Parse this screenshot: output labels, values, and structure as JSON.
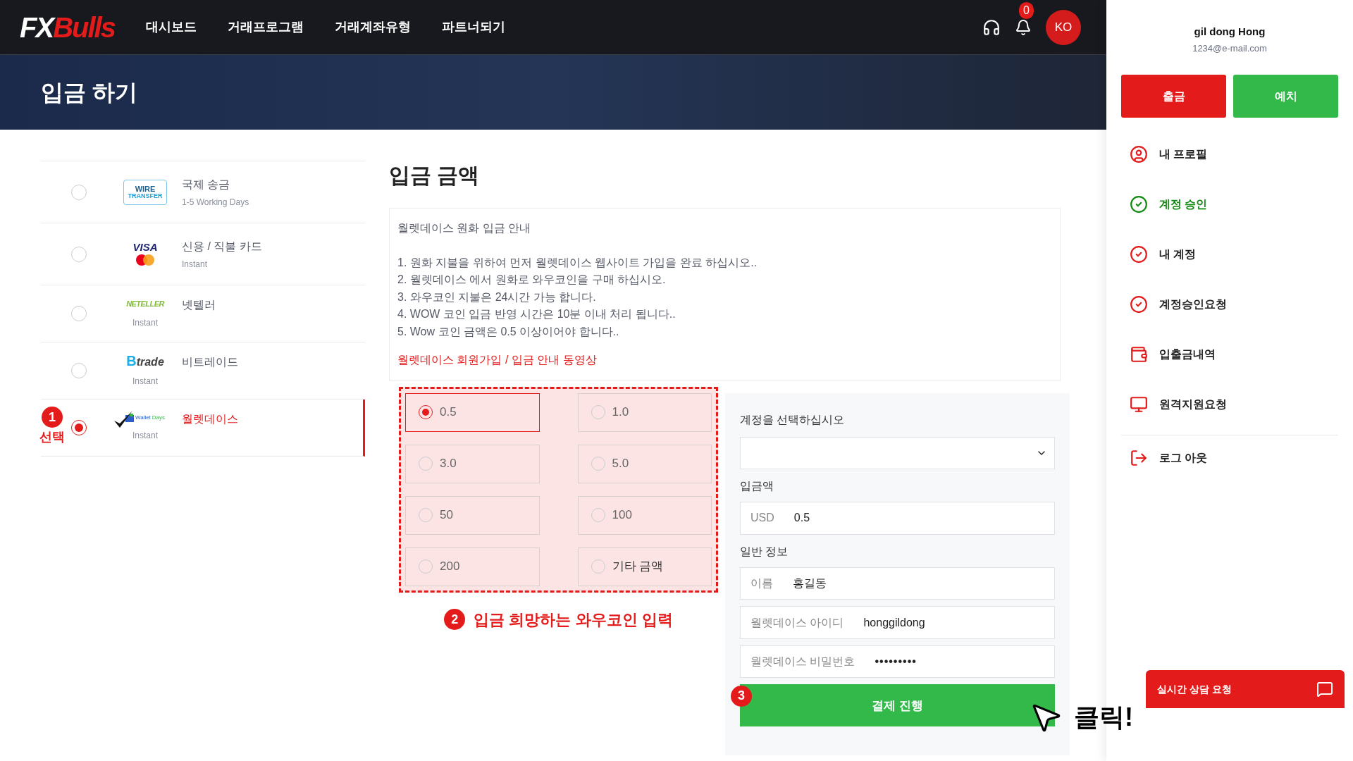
{
  "nav": {
    "logo": {
      "part1": "FX",
      "part2": "Bulls"
    },
    "items": [
      "대시보드",
      "거래프로그램",
      "거래계좌유형",
      "파트너되기"
    ],
    "notification_count": "0",
    "avatar": "KO"
  },
  "page_title": "입금 하기",
  "methods": [
    {
      "logo": {
        "kind": "wire",
        "lines": [
          "WIRE",
          "TRANSFER"
        ]
      },
      "name": "국제 송금",
      "note": "1-5 Working Days",
      "kind": "beside",
      "selected": false
    },
    {
      "logo": {
        "kind": "visa",
        "lines": [
          "VISA"
        ]
      },
      "name": "신용 / 직불 카드",
      "note": "Instant",
      "kind": "beside",
      "selected": false
    },
    {
      "logo": {
        "kind": "neteller",
        "lines": [
          "NETELLER"
        ]
      },
      "name": "넷텔러",
      "note": "Instant",
      "kind": "under",
      "selected": false
    },
    {
      "logo": {
        "kind": "btrade",
        "lines": [
          "B",
          "trade"
        ]
      },
      "name": "비트레이드",
      "note": "Instant",
      "kind": "under",
      "selected": false
    },
    {
      "logo": {
        "kind": "walletdays",
        "lines": [
          "Wallet",
          "Days"
        ]
      },
      "name": "월렛데이스",
      "note": "Instant",
      "kind": "under",
      "selected": true
    }
  ],
  "section_title": "입금 금액",
  "info": {
    "title": "월렛데이스 원화 입금 안내",
    "lines": [
      "1. 원화 지불을 위하여 먼저 월렛데이스 웹사이트 가입을 완료 하십시오..",
      "2. 월렛데이스 에서 원화로 와우코인을 구매 하십시오.",
      "3. 와우코인 지불은 24시간 가능 합니다.",
      "4. WOW 코인 입금 반영 시간은 10분 이내 처리 됩니다..",
      "5. Wow 코인 금액은 0.5 이상이어야 합니다.."
    ],
    "link": "월렛데이스 회원가입 / 입금 안내 동영상"
  },
  "amounts": [
    {
      "label": "0.5",
      "selected": true
    },
    {
      "label": "1.0",
      "selected": false
    },
    {
      "label": "3.0",
      "selected": false
    },
    {
      "label": "5.0",
      "selected": false
    },
    {
      "label": "50",
      "selected": false
    },
    {
      "label": "100",
      "selected": false
    },
    {
      "label": "200",
      "selected": false
    },
    {
      "label": "기타 금액",
      "selected": false
    }
  ],
  "form": {
    "account_label": "계정을 선택하십시오",
    "amount_label": "입금액",
    "amount": {
      "prefix": "USD",
      "value": "0.5"
    },
    "general_label": "일반 정보",
    "fields": [
      {
        "label": "이름",
        "value": "홍길동",
        "kind": "text"
      },
      {
        "label": "월렛데이스 아이디",
        "value": "honggildong",
        "kind": "text"
      },
      {
        "label": "월렛데이스 비밀번호",
        "value": "•••••••••",
        "kind": "password"
      }
    ],
    "submit": "결제 진행"
  },
  "sidebar": {
    "user_name": "gil dong Hong",
    "email": "1234@e-mail.com",
    "withdraw": "출금",
    "deposit": "예치",
    "menu": [
      {
        "kind": "user",
        "label": "내 프로필",
        "selected": false
      },
      {
        "kind": "check",
        "label": "계정 승인",
        "selected": true
      },
      {
        "kind": "check",
        "label": "내 계정",
        "selected": false
      },
      {
        "kind": "check",
        "label": "계정승인요청",
        "selected": false
      },
      {
        "kind": "wallet",
        "label": "입출금내역",
        "selected": false
      },
      {
        "kind": "monitor",
        "label": "원격지원요청",
        "selected": false
      }
    ],
    "logout": "로그 아웃",
    "chat": "실시간 상담 요청"
  },
  "annotations": {
    "step1": {
      "number": "1",
      "label": "선택"
    },
    "step2": {
      "number": "2",
      "label": "입금 희망하는 와우코인 입력"
    },
    "step3": {
      "number": "3"
    },
    "click": "클릭!"
  }
}
